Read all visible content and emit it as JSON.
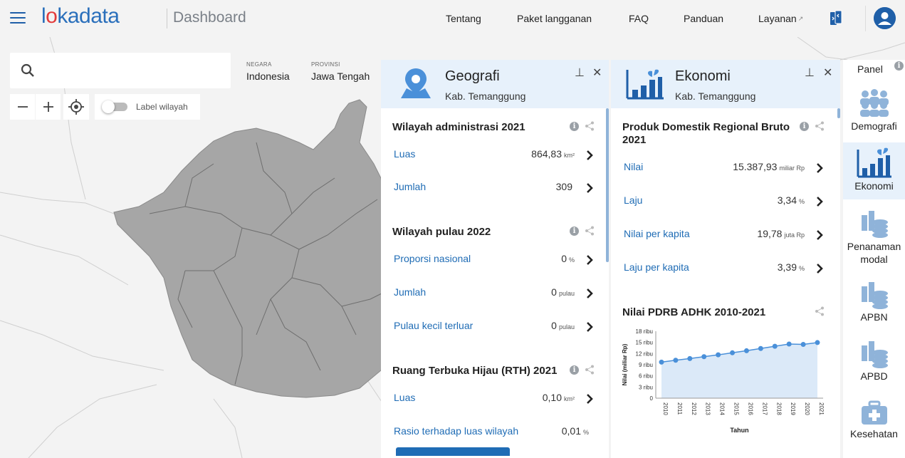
{
  "header": {
    "logo": "lokadata",
    "page_title": "Dashboard",
    "nav": [
      "Tentang",
      "Paket langganan",
      "FAQ",
      "Panduan",
      "Layanan"
    ]
  },
  "search": {
    "placeholder": ""
  },
  "breadcrumb": [
    {
      "key": "NEGARA",
      "value": "Indonesia"
    },
    {
      "key": "PROVINSI",
      "value": "Jawa Tengah"
    }
  ],
  "map_controls": {
    "toggle_label": "Label wilayah"
  },
  "geografi": {
    "title": "Geografi",
    "region": "Kab. Temanggung",
    "sections": [
      {
        "title": "Wilayah administrasi 2021",
        "rows": [
          {
            "label": "Luas",
            "value": "864,83",
            "unit": "km²"
          },
          {
            "label": "Jumlah",
            "value": "309",
            "unit": ""
          }
        ]
      },
      {
        "title": "Wilayah pulau 2022",
        "rows": [
          {
            "label": "Proporsi nasional",
            "value": "0",
            "unit": "%"
          },
          {
            "label": "Jumlah",
            "value": "0",
            "unit": "pulau"
          },
          {
            "label": "Pulau kecil terluar",
            "value": "0",
            "unit": "pulau"
          }
        ]
      },
      {
        "title": "Ruang Terbuka Hijau (RTH) 2021",
        "rows": [
          {
            "label": "Luas",
            "value": "0,10",
            "unit": "km²"
          },
          {
            "label": "Rasio terhadap luas wilayah",
            "value": "0,01",
            "unit": "%"
          }
        ]
      }
    ]
  },
  "ekonomi": {
    "title": "Ekonomi",
    "region": "Kab. Temanggung",
    "section_title": "Produk Domestik Regional Bruto 2021",
    "rows": [
      {
        "label": "Nilai",
        "value": "15.387,93",
        "unit": "miliar Rp"
      },
      {
        "label": "Laju",
        "value": "3,34",
        "unit": "%"
      },
      {
        "label": "Nilai per kapita",
        "value": "19,78",
        "unit": "juta Rp"
      },
      {
        "label": "Laju per kapita",
        "value": "3,39",
        "unit": "%"
      }
    ],
    "chart_title": "Nilai PDRB ADHK 2010-2021"
  },
  "chart_data": {
    "type": "area",
    "title": "Nilai PDRB ADHK 2010-2021",
    "xlabel": "Tahun",
    "ylabel": "Nilai (miliar Rp)",
    "x": [
      "2010",
      "2011",
      "2012",
      "2013",
      "2014",
      "2015",
      "2016",
      "2017",
      "2018",
      "2019",
      "2020",
      "2021"
    ],
    "series": [
      {
        "values": [
          9700,
          10200,
          10650,
          11150,
          11650,
          12200,
          12750,
          13350,
          13950,
          14550,
          14450,
          14950
        ]
      }
    ],
    "ylim": [
      0,
      18000
    ],
    "yticks": [
      "0",
      "3 ribu",
      "6 ribu",
      "9 ribu",
      "12 ribu",
      "15 ribu",
      "18 ribu"
    ],
    "grid": false,
    "colors": {
      "line": "#4a90d9",
      "fill": "#dbe9f8"
    }
  },
  "side_panel": {
    "title": "Panel",
    "items": [
      {
        "label": "Demografi",
        "icon": "people-icon"
      },
      {
        "label": "Ekonomi",
        "icon": "bar-chart-plant-icon"
      },
      {
        "label": "Penanaman modal",
        "icon": "coins-icon"
      },
      {
        "label": "APBN",
        "icon": "coins-icon"
      },
      {
        "label": "APBD",
        "icon": "coins-icon"
      },
      {
        "label": "Kesehatan",
        "icon": "medical-kit-icon"
      }
    ]
  },
  "colors": {
    "brand": "#2a6fbb",
    "accent": "#e23b3b",
    "link": "#1f6cb5",
    "panel_header": "#e7f1fb",
    "map_region": "#a6a6a6"
  }
}
